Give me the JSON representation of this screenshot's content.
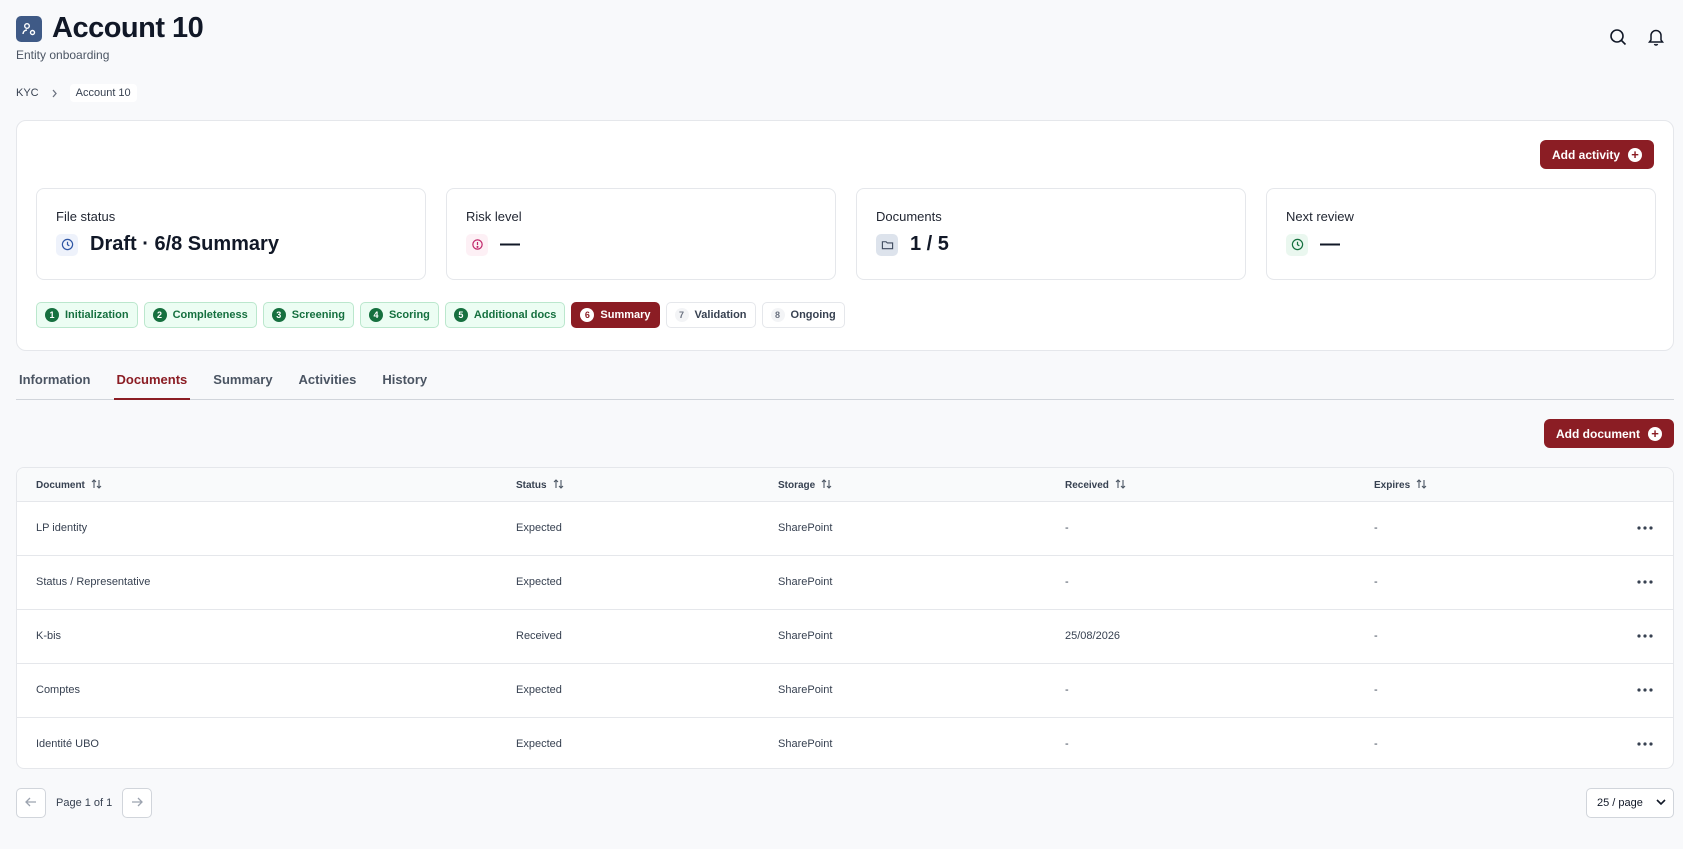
{
  "header": {
    "title": "Account 10",
    "subtitle": "Entity onboarding"
  },
  "breadcrumb": {
    "root": "KYC",
    "current": "Account 10"
  },
  "overview": {
    "add_activity_label": "Add activity",
    "stats": [
      {
        "label": "File status",
        "value": "Draft · 6/8 Summary",
        "icon": "clock-icon"
      },
      {
        "label": "Risk level",
        "value": "—",
        "icon": "alert-circle-icon"
      },
      {
        "label": "Documents",
        "value": "1 / 5",
        "icon": "folder-icon"
      },
      {
        "label": "Next review",
        "value": "—",
        "icon": "clock-icon"
      }
    ],
    "steps": [
      {
        "num": "1",
        "label": "Initialization",
        "state": "done"
      },
      {
        "num": "2",
        "label": "Completeness",
        "state": "done"
      },
      {
        "num": "3",
        "label": "Screening",
        "state": "done"
      },
      {
        "num": "4",
        "label": "Scoring",
        "state": "done"
      },
      {
        "num": "5",
        "label": "Additional docs",
        "state": "done"
      },
      {
        "num": "6",
        "label": "Summary",
        "state": "current"
      },
      {
        "num": "7",
        "label": "Validation",
        "state": "todo"
      },
      {
        "num": "8",
        "label": "Ongoing",
        "state": "todo"
      }
    ]
  },
  "tabs": [
    {
      "label": "Information",
      "active": false
    },
    {
      "label": "Documents",
      "active": true
    },
    {
      "label": "Summary",
      "active": false
    },
    {
      "label": "Activities",
      "active": false
    },
    {
      "label": "History",
      "active": false
    }
  ],
  "documents": {
    "add_document_label": "Add document",
    "columns": [
      "Document",
      "Status",
      "Storage",
      "Received",
      "Expires"
    ],
    "rows": [
      {
        "document": "LP identity",
        "status": "Expected",
        "storage": "SharePoint",
        "received": "-",
        "expires": "-"
      },
      {
        "document": "Status / Representative",
        "status": "Expected",
        "storage": "SharePoint",
        "received": "-",
        "expires": "-"
      },
      {
        "document": "K-bis",
        "status": "Received",
        "storage": "SharePoint",
        "received": "25/08/2026",
        "expires": "-"
      },
      {
        "document": "Comptes",
        "status": "Expected",
        "storage": "SharePoint",
        "received": "-",
        "expires": "-"
      },
      {
        "document": "Identité UBO",
        "status": "Expected",
        "storage": "SharePoint",
        "received": "-",
        "expires": "-"
      }
    ]
  },
  "pagination": {
    "page_text": "Page 1 of 1",
    "page_size": "25 / page"
  },
  "colors": {
    "accent": "#8b1d24",
    "success": "#16703f",
    "app_icon": "#3f5a86"
  }
}
